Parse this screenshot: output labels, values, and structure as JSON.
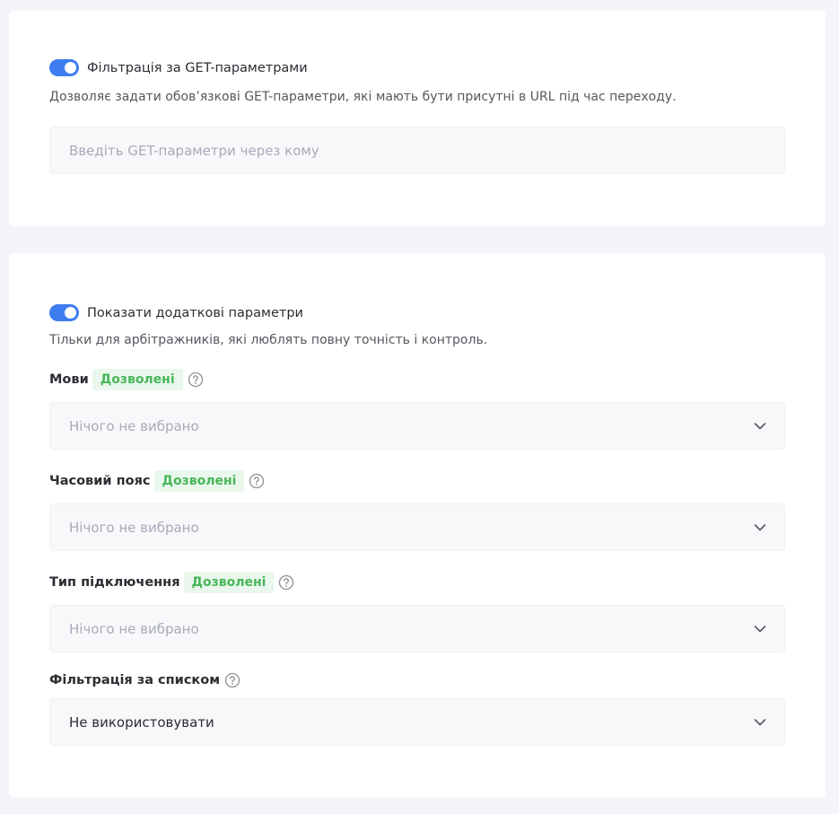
{
  "get_filter": {
    "toggle_label": "Фільтрація за GET-параметрами",
    "toggle_on": true,
    "description": "Дозволяє задати обов’язкові GET-параметри, які мають бути присутні в URL під час переходу.",
    "input_placeholder": "Введіть GET-параметри через кому",
    "input_value": ""
  },
  "advanced": {
    "toggle_label": "Показати додаткові параметри",
    "toggle_on": true,
    "description": "Тільки для арбітражників, які люблять повну точність і контроль.",
    "fields": [
      {
        "label": "Мови",
        "badge": "Дозволені",
        "value": "Нічого не вибрано",
        "help_icon": "question-circle-icon"
      },
      {
        "label": "Часовий пояс",
        "badge": "Дозволені",
        "value": "Нічого не вибрано",
        "help_icon": "question-circle-icon"
      },
      {
        "label": "Тип підключення",
        "badge": "Дозволені",
        "value": "Нічого не вибрано",
        "help_icon": "question-circle-icon"
      },
      {
        "label": "Фільтрація за списком",
        "value": "Не використовувати",
        "help_icon": "question-circle-icon"
      }
    ]
  },
  "colors": {
    "accent": "#3d7df0",
    "badge_text": "#47b75a",
    "badge_bg": "#eaf7ec",
    "page_bg": "#f4f5fa"
  }
}
